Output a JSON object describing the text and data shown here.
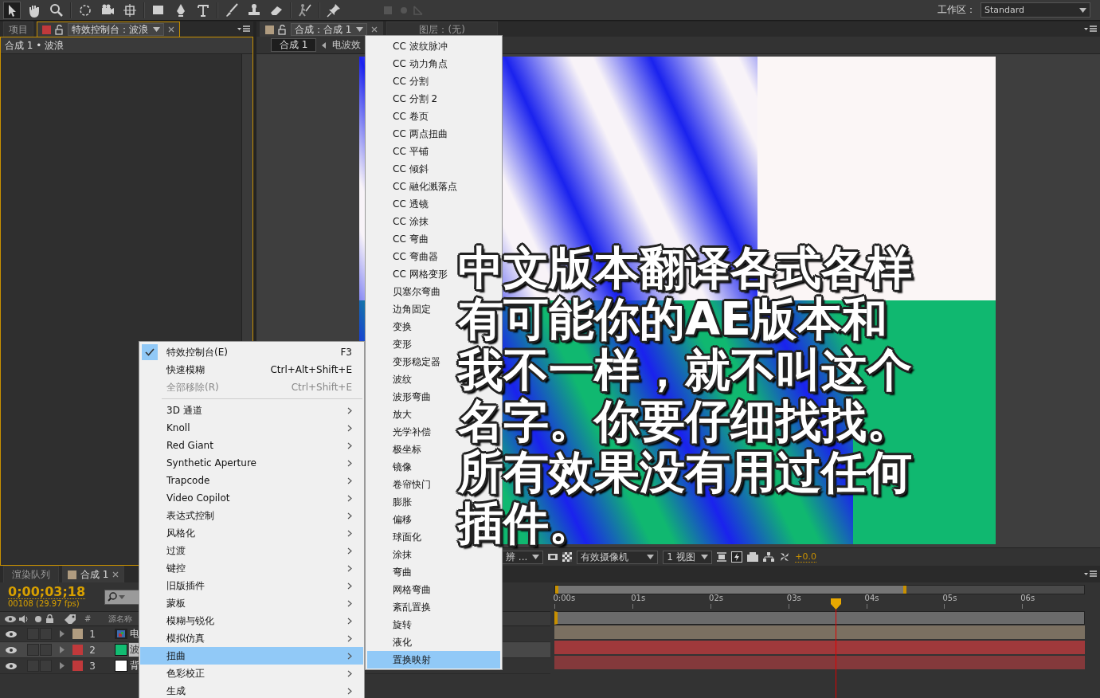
{
  "toolbar": {
    "workspace_label": "工作区：",
    "workspace": "Standard"
  },
  "left_panel": {
    "tabs": [
      {
        "label": "项目",
        "selected": false
      },
      {
        "label": "特效控制台：波浪",
        "selected": true
      }
    ],
    "breadcrumb": "合成 1 • 波浪"
  },
  "viewer_panel": {
    "tabs": [
      {
        "label": "合成：合成 1",
        "selected": true
      },
      {
        "label": "图层：(无)",
        "selected": false
      }
    ],
    "comp_button": "合成 1",
    "flow_item": "电波效",
    "footer": {
      "resolution": "辨 ...",
      "camera": "有效摄像机",
      "views": "1 视图",
      "exposure": "+0.0"
    }
  },
  "timeline": {
    "tabs": [
      {
        "label": "渲染队列",
        "selected": false
      },
      {
        "label": "合成 1",
        "selected": true
      }
    ],
    "timecode": "0;00;03;18",
    "frame_info": "00108 (29.97 fps)",
    "columns": [
      "#",
      "源名称"
    ],
    "layers": [
      {
        "number": "1",
        "name": "电",
        "color": "#b09c80",
        "kind": "footage",
        "selected": false
      },
      {
        "number": "2",
        "name": "波",
        "color": "#c0393b",
        "kind": "solid",
        "source": {
          "color": "#12bc72"
        },
        "selected": true
      },
      {
        "number": "3",
        "name": "背",
        "color": "#c0393b",
        "kind": "solid",
        "source": {
          "color": "#ffffff"
        },
        "selected": false
      }
    ],
    "ruler": [
      "0:00s",
      "01s",
      "02s",
      "03s",
      "04s",
      "05s",
      "06s"
    ]
  },
  "effect_menu": [
    {
      "kind": "command",
      "label": "特效控制台(E)",
      "shortcut": "F3",
      "checked": true,
      "disabled": false
    },
    {
      "kind": "command",
      "label": "快速模糊",
      "shortcut": "Ctrl+Alt+Shift+E",
      "checked": false,
      "disabled": false
    },
    {
      "kind": "command",
      "label": "全部移除(R)",
      "shortcut": "Ctrl+Shift+E",
      "checked": false,
      "disabled": true
    },
    {
      "kind": "separator"
    },
    {
      "kind": "submenu",
      "label": "3D 通道",
      "selected": false
    },
    {
      "kind": "submenu",
      "label": "Knoll",
      "selected": false
    },
    {
      "kind": "submenu",
      "label": "Red Giant",
      "selected": false
    },
    {
      "kind": "submenu",
      "label": "Synthetic Aperture",
      "selected": false
    },
    {
      "kind": "submenu",
      "label": "Trapcode",
      "selected": false
    },
    {
      "kind": "submenu",
      "label": "Video Copilot",
      "selected": false
    },
    {
      "kind": "submenu",
      "label": "表达式控制",
      "selected": false
    },
    {
      "kind": "submenu",
      "label": "风格化",
      "selected": false
    },
    {
      "kind": "submenu",
      "label": "过渡",
      "selected": false
    },
    {
      "kind": "submenu",
      "label": "键控",
      "selected": false
    },
    {
      "kind": "submenu",
      "label": "旧版插件",
      "selected": false
    },
    {
      "kind": "submenu",
      "label": "蒙板",
      "selected": false
    },
    {
      "kind": "submenu",
      "label": "模糊与锐化",
      "selected": false
    },
    {
      "kind": "submenu",
      "label": "模拟仿真",
      "selected": false
    },
    {
      "kind": "submenu",
      "label": "扭曲",
      "selected": true
    },
    {
      "kind": "submenu",
      "label": "色彩校正",
      "selected": false
    },
    {
      "kind": "submenu",
      "label": "生成",
      "selected": false
    }
  ],
  "distort_submenu": [
    {
      "label": "CC 波纹脉冲",
      "selected": false
    },
    {
      "label": "CC 动力角点",
      "selected": false
    },
    {
      "label": "CC 分割",
      "selected": false
    },
    {
      "label": "CC 分割 2",
      "selected": false
    },
    {
      "label": "CC 卷页",
      "selected": false
    },
    {
      "label": "CC 两点扭曲",
      "selected": false
    },
    {
      "label": "CC 平铺",
      "selected": false
    },
    {
      "label": "CC 倾斜",
      "selected": false
    },
    {
      "label": "CC 融化溅落点",
      "selected": false
    },
    {
      "label": "CC 透镜",
      "selected": false
    },
    {
      "label": "CC 涂抹",
      "selected": false
    },
    {
      "label": "CC 弯曲",
      "selected": false
    },
    {
      "label": "CC 弯曲器",
      "selected": false
    },
    {
      "label": "CC 网格变形",
      "selected": false
    },
    {
      "label": "贝塞尔弯曲",
      "selected": false
    },
    {
      "label": "边角固定",
      "selected": false
    },
    {
      "label": "变换",
      "selected": false
    },
    {
      "label": "变形",
      "selected": false
    },
    {
      "label": "变形稳定器",
      "selected": false
    },
    {
      "label": "波纹",
      "selected": false
    },
    {
      "label": "波形弯曲",
      "selected": false
    },
    {
      "label": "放大",
      "selected": false
    },
    {
      "label": "光学补偿",
      "selected": false
    },
    {
      "label": "极坐标",
      "selected": false
    },
    {
      "label": "镜像",
      "selected": false
    },
    {
      "label": "卷帘快门",
      "selected": false
    },
    {
      "label": "膨胀",
      "selected": false
    },
    {
      "label": "偏移",
      "selected": false
    },
    {
      "label": "球面化",
      "selected": false
    },
    {
      "label": "涂抹",
      "selected": false
    },
    {
      "label": "弯曲",
      "selected": false
    },
    {
      "label": "网格弯曲",
      "selected": false
    },
    {
      "label": "紊乱置换",
      "selected": false
    },
    {
      "label": "旋转",
      "selected": false
    },
    {
      "label": "液化",
      "selected": false
    },
    {
      "label": "置换映射",
      "selected": true
    }
  ],
  "caption": [
    "中文版本翻译各式各样",
    "有可能你的AE版本和",
    "我不一样，就不叫这个",
    "名字。你要仔细找找。",
    "所有效果没有用过任何",
    "插件。"
  ]
}
